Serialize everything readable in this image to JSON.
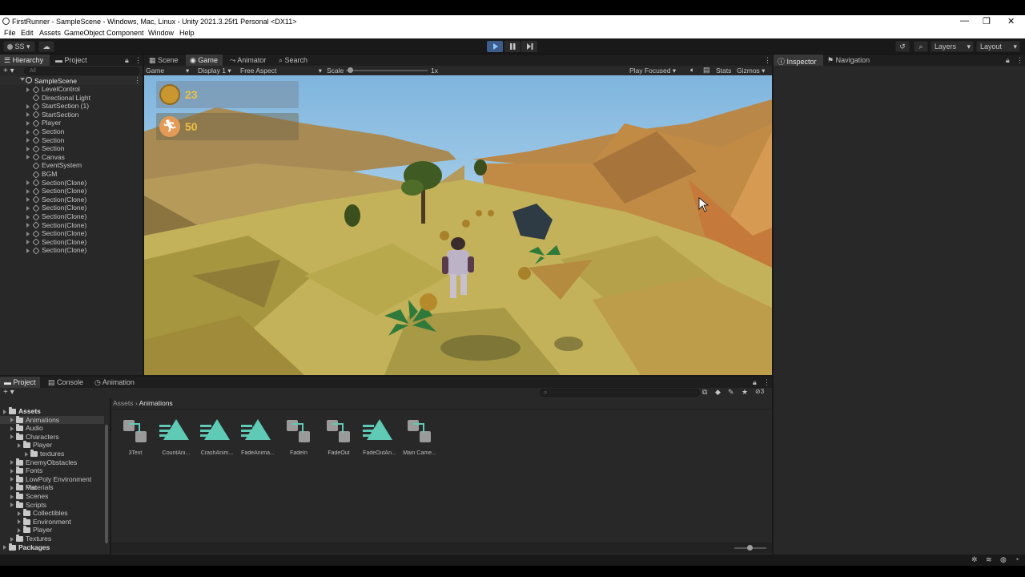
{
  "window": {
    "title": "FirstRunner - SampleScene - Windows, Mac, Linux - Unity 2021.3.25f1 Personal <DX11>",
    "controls": [
      "—",
      "❐",
      "✕"
    ]
  },
  "menu": [
    "File",
    "Edit",
    "Assets",
    "GameObject",
    "Component",
    "Window",
    "Help"
  ],
  "toolbar": {
    "account": "SS",
    "layers_label": "Layers",
    "layout_label": "Layout"
  },
  "hierarchy": {
    "tabs": [
      "Hierarchy",
      "Project"
    ],
    "search_placeholder": "All",
    "scene": "SampleScene",
    "items": [
      {
        "name": "LevelControl",
        "expandable": true
      },
      {
        "name": "Directional Light",
        "expandable": false
      },
      {
        "name": "StartSection (1)",
        "expandable": true
      },
      {
        "name": "StartSection",
        "expandable": true
      },
      {
        "name": "Player",
        "expandable": true
      },
      {
        "name": "Section",
        "expandable": true
      },
      {
        "name": "Section",
        "expandable": true
      },
      {
        "name": "Section",
        "expandable": true
      },
      {
        "name": "Canvas",
        "expandable": true
      },
      {
        "name": "EventSystem",
        "expandable": false
      },
      {
        "name": "BGM",
        "expandable": false
      },
      {
        "name": "Section(Clone)",
        "expandable": true
      },
      {
        "name": "Section(Clone)",
        "expandable": true
      },
      {
        "name": "Section(Clone)",
        "expandable": true
      },
      {
        "name": "Section(Clone)",
        "expandable": true
      },
      {
        "name": "Section(Clone)",
        "expandable": true
      },
      {
        "name": "Section(Clone)",
        "expandable": true
      },
      {
        "name": "Section(Clone)",
        "expandable": true
      },
      {
        "name": "Section(Clone)",
        "expandable": true
      },
      {
        "name": "Section(Clone)",
        "expandable": true
      }
    ]
  },
  "center": {
    "tabs": [
      "Scene",
      "Game",
      "Animator",
      "Search"
    ],
    "active_tab": "Game",
    "game_toolbar": {
      "mode": "Game",
      "display": "Display 1",
      "aspect": "Free Aspect",
      "scale_label": "Scale",
      "scale_value": "1x",
      "play_focused": "Play Focused",
      "stats": "Stats",
      "gizmos": "Gizmos"
    },
    "hud": {
      "coins": "23",
      "distance": "50"
    }
  },
  "inspector": {
    "tabs": [
      "Inspector",
      "Navigation"
    ]
  },
  "bottom": {
    "tabs": [
      "Project",
      "Console",
      "Animation"
    ],
    "breadcrumb": [
      "Assets",
      "Animations"
    ],
    "hidden_count": "3",
    "tree": [
      {
        "name": "Assets",
        "depth": 0,
        "bold": true,
        "selected": false
      },
      {
        "name": "Animations",
        "depth": 1,
        "bold": false,
        "selected": true
      },
      {
        "name": "Audio",
        "depth": 1,
        "bold": false,
        "selected": false
      },
      {
        "name": "Characters",
        "depth": 1,
        "bold": false,
        "selected": false
      },
      {
        "name": "Player",
        "depth": 2,
        "bold": false,
        "selected": false
      },
      {
        "name": "textures",
        "depth": 3,
        "bold": false,
        "selected": false
      },
      {
        "name": "EnemyObstacles",
        "depth": 1,
        "bold": false,
        "selected": false
      },
      {
        "name": "Fonts",
        "depth": 1,
        "bold": false,
        "selected": false
      },
      {
        "name": "LowPoly Environment Pac",
        "depth": 1,
        "bold": false,
        "selected": false
      },
      {
        "name": "Materials",
        "depth": 1,
        "bold": false,
        "selected": false
      },
      {
        "name": "Scenes",
        "depth": 1,
        "bold": false,
        "selected": false
      },
      {
        "name": "Scripts",
        "depth": 1,
        "bold": false,
        "selected": false
      },
      {
        "name": "Collectibles",
        "depth": 2,
        "bold": false,
        "selected": false
      },
      {
        "name": "Environment",
        "depth": 2,
        "bold": false,
        "selected": false
      },
      {
        "name": "Player",
        "depth": 2,
        "bold": false,
        "selected": false
      },
      {
        "name": "Textures",
        "depth": 1,
        "bold": false,
        "selected": false
      },
      {
        "name": "Packages",
        "depth": 0,
        "bold": true,
        "selected": false
      }
    ],
    "assets": [
      {
        "label": "3Text",
        "kind": "controller"
      },
      {
        "label": "CountAni...",
        "kind": "clip"
      },
      {
        "label": "CrashAnim...",
        "kind": "clip"
      },
      {
        "label": "FadeAnima...",
        "kind": "clip"
      },
      {
        "label": "FadeIn",
        "kind": "controller"
      },
      {
        "label": "FadeOut",
        "kind": "controller"
      },
      {
        "label": "FadeOutAn...",
        "kind": "clip"
      },
      {
        "label": "Main Came...",
        "kind": "controller"
      }
    ]
  },
  "colors": {
    "accent": "#3c5c8a",
    "clip_icon": "#5fcab5",
    "hud_text": "#f0c040",
    "sky": "#9ec9ea",
    "sand": "#c9b35a"
  }
}
